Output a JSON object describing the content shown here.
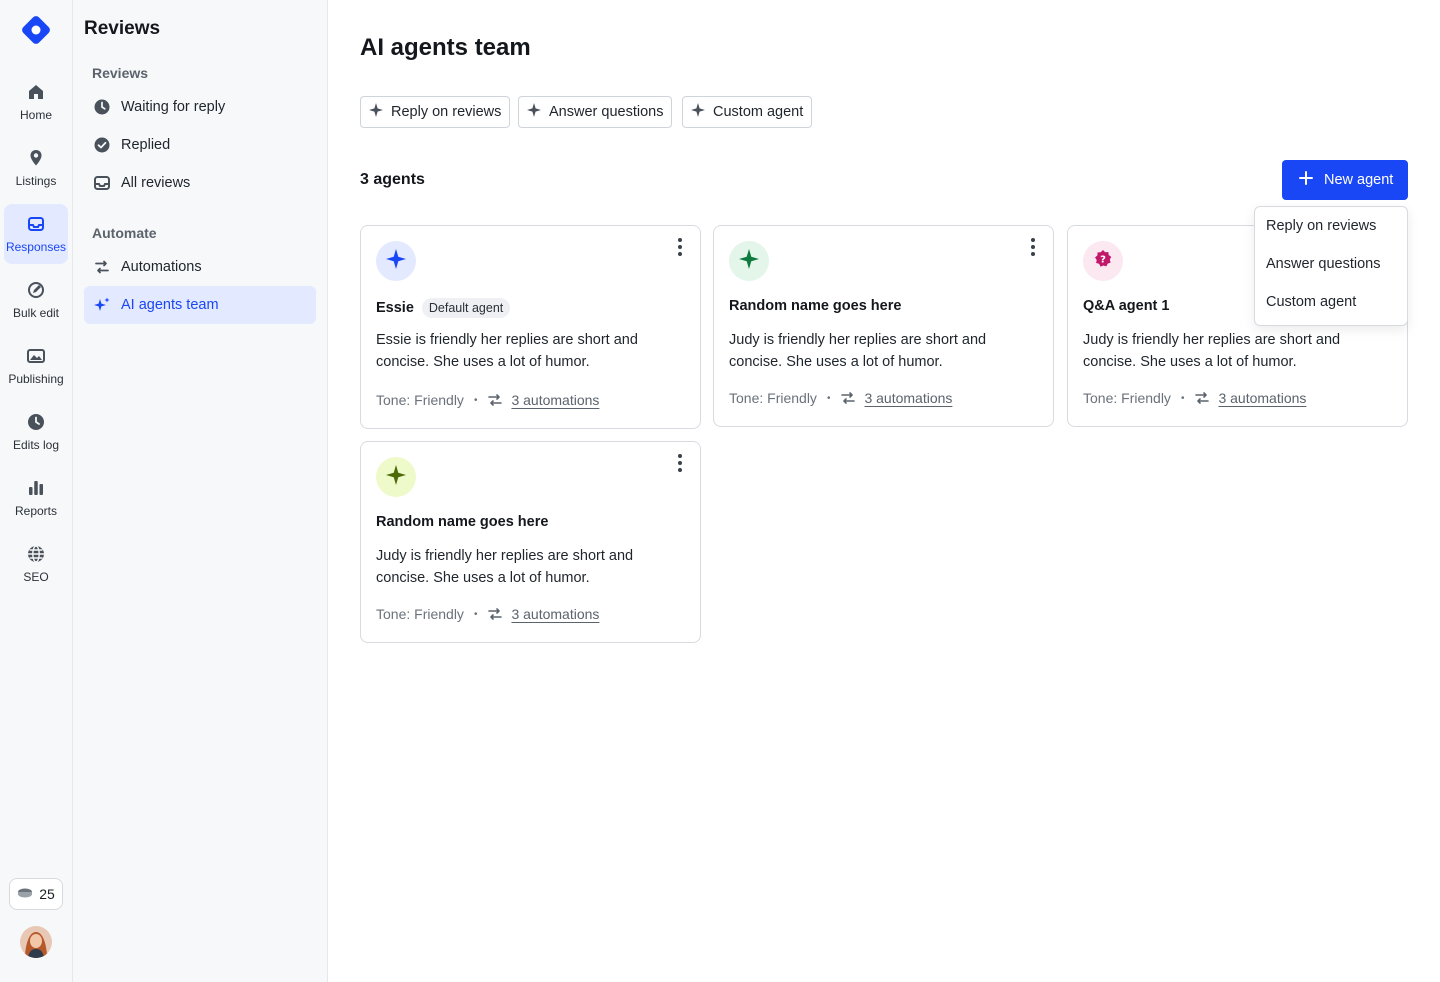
{
  "rail": {
    "items": [
      {
        "label": "Home",
        "icon": "home-icon"
      },
      {
        "label": "Listings",
        "icon": "map-pin-icon"
      },
      {
        "label": "Responses",
        "icon": "inbox-icon",
        "active": true
      },
      {
        "label": "Bulk edit",
        "icon": "bulk-edit-icon"
      },
      {
        "label": "Publishing",
        "icon": "images-icon"
      },
      {
        "label": "Edits log",
        "icon": "clock-icon"
      },
      {
        "label": "Reports",
        "icon": "bar-chart-icon"
      },
      {
        "label": "SEO",
        "icon": "globe-icon"
      }
    ],
    "credits": "25",
    "brand_color": "#1a47f5"
  },
  "sidebar": {
    "title": "Reviews",
    "sections": [
      {
        "title": "Reviews",
        "items": [
          {
            "label": "Waiting for reply",
            "icon": "clock-icon"
          },
          {
            "label": "Replied",
            "icon": "check-circle-icon"
          },
          {
            "label": "All reviews",
            "icon": "inbox-icon"
          }
        ]
      },
      {
        "title": "Automate",
        "items": [
          {
            "label": "Automations",
            "icon": "automation-icon"
          },
          {
            "label": "AI agents team",
            "icon": "sparkles-icon",
            "active": true
          }
        ]
      }
    ]
  },
  "main": {
    "title": "AI agents team",
    "chips": [
      "Reply on reviews",
      "Answer questions",
      "Custom agent"
    ],
    "agent_count": "3 agents",
    "new_agent_button": "New agent",
    "new_agent_menu": [
      "Reply on reviews",
      "Answer questions",
      "Custom agent"
    ],
    "agents": [
      {
        "name": "Essie",
        "badge": "Default agent",
        "description": "Essie is friendly her replies are short and concise. She uses a lot of humor.",
        "tone": "Tone: Friendly",
        "automations": "3 automations",
        "icon": "sparkle-icon",
        "icon_bg": "#e3e9ff",
        "icon_color": "#1a47f5"
      },
      {
        "name": "Random name goes here",
        "badge": "",
        "description": "Judy is friendly her replies are short and concise. She uses a lot of humor.",
        "tone": "Tone: Friendly",
        "automations": "3 automations",
        "icon": "sparkle-icon",
        "icon_bg": "#e4f5ea",
        "icon_color": "#0f7a3e"
      },
      {
        "name": "Q&A agent 1",
        "badge": "",
        "description": "Judy is friendly her replies are short and concise. She uses a lot of humor.",
        "tone": "Tone: Friendly",
        "automations": "3 automations",
        "icon": "question-badge-icon",
        "icon_bg": "#fbe8f1",
        "icon_color": "#c2186a"
      },
      {
        "name": "Random name goes here",
        "badge": "",
        "description": "Judy is friendly her replies are short and concise. She uses a lot of humor.",
        "tone": "Tone: Friendly",
        "automations": "3 automations",
        "icon": "sparkle-icon",
        "icon_bg": "#eefac9",
        "icon_color": "#4d6a0a"
      }
    ]
  }
}
